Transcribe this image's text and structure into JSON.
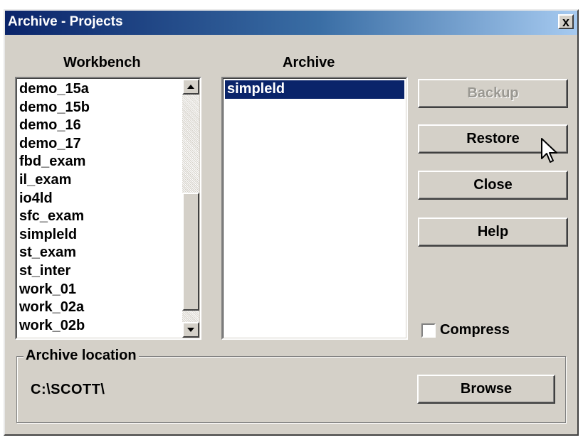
{
  "window": {
    "title": "Archive - Projects",
    "close_label": "x"
  },
  "workbench": {
    "label": "Workbench",
    "items": [
      "demo_15a",
      "demo_15b",
      "demo_16",
      "demo_17",
      "fbd_exam",
      "il_exam",
      "io4ld",
      "sfc_exam",
      "simpleld",
      "st_exam",
      "st_inter",
      "work_01",
      "work_02a",
      "work_02b"
    ]
  },
  "archive": {
    "label": "Archive",
    "items": [
      "simpleld"
    ],
    "selected_item": "simpleld"
  },
  "buttons": {
    "backup": "Backup",
    "restore": "Restore",
    "close": "Close",
    "help": "Help",
    "browse": "Browse"
  },
  "compress": {
    "label": "Compress",
    "checked": false
  },
  "archive_location": {
    "label": "Archive location",
    "path": "C:\\SCOTT\\"
  },
  "colors": {
    "face": "#d4d0c8",
    "selection": "#0a246a",
    "title_gradient_start": "#0a246a",
    "title_gradient_end": "#a6caf0"
  },
  "icons": {
    "close": "close-x-icon",
    "scroll_up": "scroll-up-arrow-icon",
    "scroll_down": "scroll-down-arrow-icon",
    "cursor": "mouse-pointer-icon"
  }
}
